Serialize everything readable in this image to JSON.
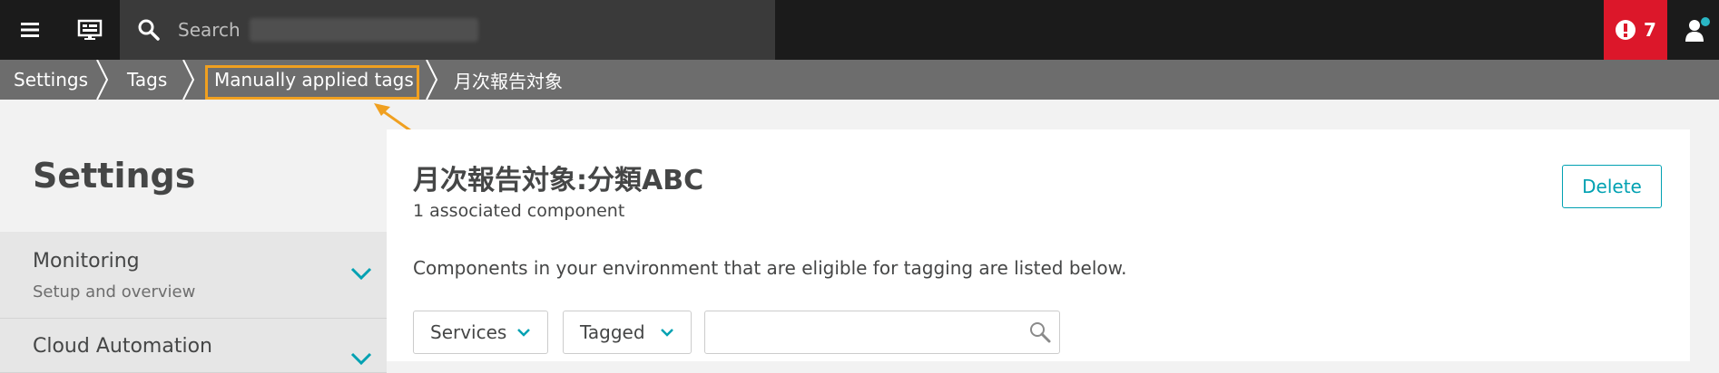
{
  "topbar": {
    "search_placeholder": "Search",
    "alert_count": "7",
    "icons": [
      "menu-icon",
      "dashboard-icon",
      "search-icon",
      "alert-icon",
      "user-icon"
    ],
    "alert_color": "#dc172a",
    "notification_dot_color": "#2ab6c4"
  },
  "breadcrumb": {
    "items": [
      "Settings",
      "Tags",
      "Manually applied tags",
      "月次報告対象"
    ],
    "highlight_color": "#f0a020"
  },
  "sidebar": {
    "title": "Settings",
    "sections": [
      {
        "label": "Monitoring",
        "sublabel": "Setup and overview"
      },
      {
        "label": "Cloud Automation",
        "sublabel": ""
      }
    ]
  },
  "main": {
    "tag_title": "月次報告対象:分類ABC",
    "associated_count": "1 associated component",
    "delete_label": "Delete",
    "description": "Components in your environment that are eligible for tagging are listed below.",
    "filter_type": "Services",
    "filter_status": "Tagged",
    "filter_input_value": "",
    "accent_color": "#00a1b2"
  }
}
